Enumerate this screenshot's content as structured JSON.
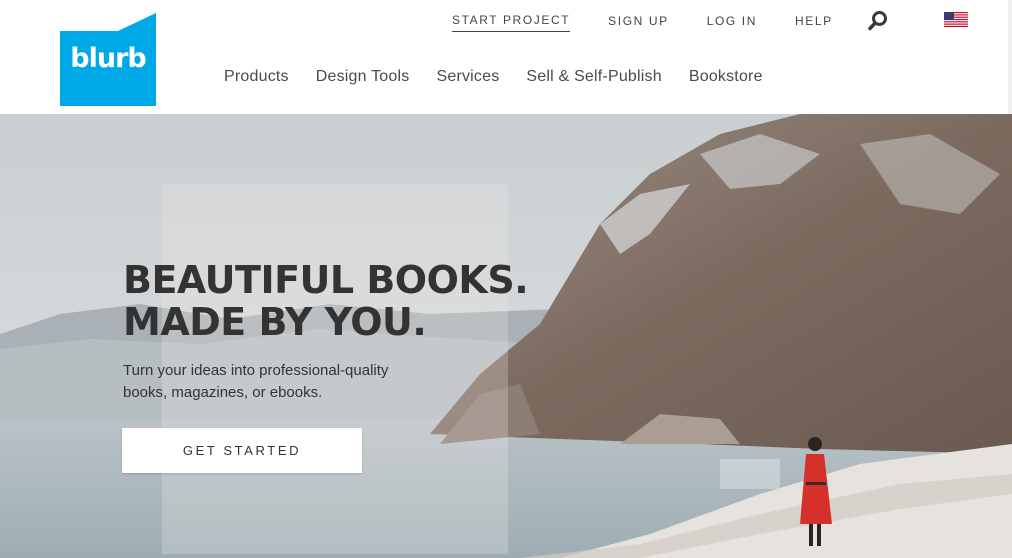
{
  "brand": {
    "logo_text": "blurb",
    "color": "#00a8e8"
  },
  "util_nav": [
    {
      "label": "START PROJECT",
      "active": true
    },
    {
      "label": "SIGN UP"
    },
    {
      "label": "LOG IN"
    },
    {
      "label": "HELP"
    }
  ],
  "icons": {
    "search": "search-icon",
    "flag": "us-flag-icon"
  },
  "main_nav": [
    {
      "label": "Products"
    },
    {
      "label": "Design Tools"
    },
    {
      "label": "Services"
    },
    {
      "label": "Sell & Self-Publish"
    },
    {
      "label": "Bookstore"
    }
  ],
  "hero": {
    "headline_line1": "BEAUTIFUL BOOKS.",
    "headline_line2": "MADE BY YOU.",
    "subtext": "Turn your ideas into professional-quality books, magazines, or ebooks.",
    "cta": "GET STARTED"
  }
}
